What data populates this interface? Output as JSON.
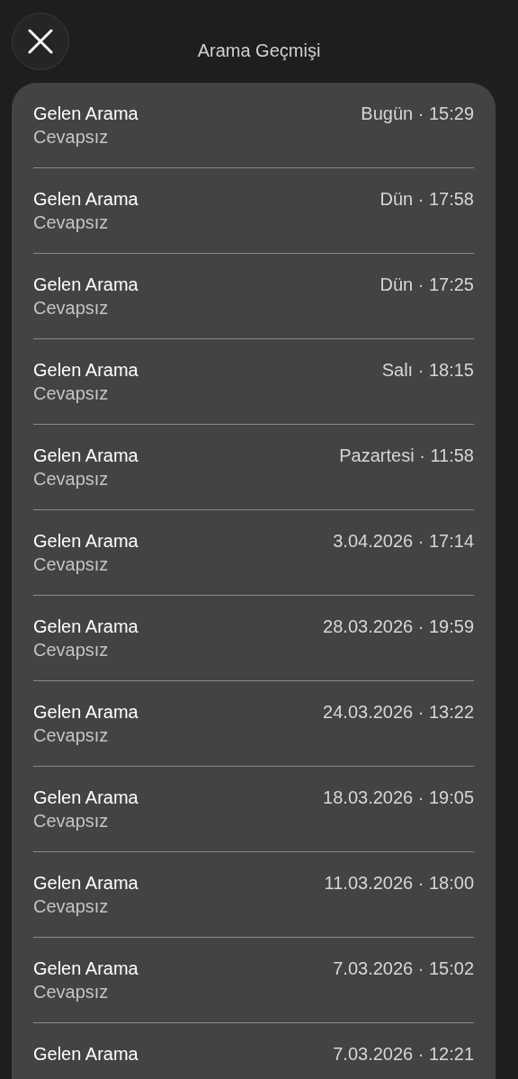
{
  "header": {
    "title": "Arama Geçmişi"
  },
  "calls": [
    {
      "type": "Gelen Arama",
      "status": "Cevapsız",
      "time": "Bugün · 15:29"
    },
    {
      "type": "Gelen Arama",
      "status": "Cevapsız",
      "time": "Dün · 17:58"
    },
    {
      "type": "Gelen Arama",
      "status": "Cevapsız",
      "time": "Dün · 17:25"
    },
    {
      "type": "Gelen Arama",
      "status": "Cevapsız",
      "time": "Salı · 18:15"
    },
    {
      "type": "Gelen Arama",
      "status": "Cevapsız",
      "time": "Pazartesi · 11:58"
    },
    {
      "type": "Gelen Arama",
      "status": "Cevapsız",
      "time": "3.04.2026 · 17:14"
    },
    {
      "type": "Gelen Arama",
      "status": "Cevapsız",
      "time": "28.03.2026 · 19:59"
    },
    {
      "type": "Gelen Arama",
      "status": "Cevapsız",
      "time": "24.03.2026 · 13:22"
    },
    {
      "type": "Gelen Arama",
      "status": "Cevapsız",
      "time": "18.03.2026 · 19:05"
    },
    {
      "type": "Gelen Arama",
      "status": "Cevapsız",
      "time": "11.03.2026 · 18:00"
    },
    {
      "type": "Gelen Arama",
      "status": "Cevapsız",
      "time": "7.03.2026 · 15:02"
    },
    {
      "type": "Gelen Arama",
      "time": "7.03.2026 · 12:21"
    }
  ]
}
